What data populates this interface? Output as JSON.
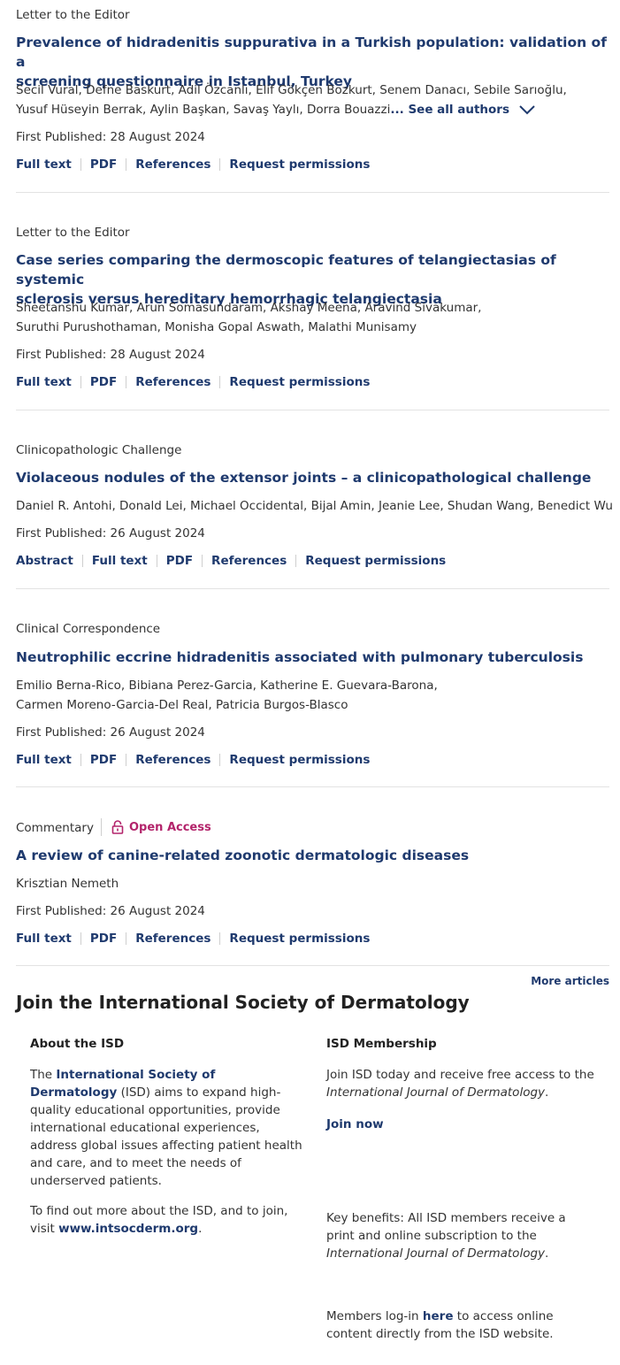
{
  "articles": [
    {
      "type": "Letter to the Editor",
      "title_lines": [
        "Prevalence of hidradenitis suppurativa in a Turkish population: validation of a",
        "screening questionnaire in Istanbul, Turkey"
      ],
      "author_lines": [
        "Secil Vural, Defne Baskurt, Adil Özcanlı, Elif Gökçen Bozkurt, Senem Danacı, Sebile Sarıoğlu,",
        "Yusuf Hüseyin Berrak, Aylin Başkan, Savaş Yaylı, Dorra Bouazzi"
      ],
      "see_all": "... See all authors",
      "first_published": "First Published:  28 August 2024",
      "links": [
        "Full text",
        "PDF",
        "References",
        "Request permissions"
      ]
    },
    {
      "type": "Letter to the Editor",
      "title_lines": [
        "Case series comparing the dermoscopic features of telangiectasias of systemic",
        "sclerosis versus hereditary hemorrhagic telangiectasia"
      ],
      "author_lines": [
        "Sheetanshu Kumar, Arun Somasundaram, Akshay Meena, Aravind Sivakumar,",
        "Suruthi Purushothaman, Monisha Gopal Aswath, Malathi Munisamy"
      ],
      "first_published": "First Published:  28 August 2024",
      "links": [
        "Full text",
        "PDF",
        "References",
        "Request permissions"
      ]
    },
    {
      "type": "Clinicopathologic Challenge",
      "title_lines": [
        "Violaceous nodules of the extensor joints – a clinicopathological challenge"
      ],
      "author_lines": [
        "Daniel R. Antohi, Donald Lei, Michael Occidental, Bijal Amin, Jeanie Lee, Shudan Wang, Benedict Wu"
      ],
      "first_published": "First Published:  26 August 2024",
      "links": [
        "Abstract",
        "Full text",
        "PDF",
        "References",
        "Request permissions"
      ]
    },
    {
      "type": "Clinical Correspondence",
      "title_lines": [
        "Neutrophilic eccrine hidradenitis associated with pulmonary tuberculosis"
      ],
      "author_lines": [
        "Emilio Berna-Rico, Bibiana Perez-Garcia, Katherine E. Guevara-Barona,",
        "Carmen Moreno-Garcia-Del Real, Patricia Burgos-Blasco"
      ],
      "first_published": "First Published:  26 August 2024",
      "links": [
        "Full text",
        "PDF",
        "References",
        "Request permissions"
      ]
    },
    {
      "type": "Commentary",
      "open_access": "Open Access",
      "title_lines": [
        "A review of canine-related zoonotic dermatologic diseases"
      ],
      "author_lines": [
        "Krisztian Nemeth"
      ],
      "first_published": "First Published:  26 August 2024",
      "links": [
        "Full text",
        "PDF",
        "References",
        "Request permissions"
      ]
    }
  ],
  "more_articles": "More articles",
  "isd": {
    "title": "Join the International Society of Dermatology",
    "about": {
      "heading": "About the ISD",
      "p1_pre": "The ",
      "p1_link": "International Society of Dermatology",
      "p1_post": " (ISD) aims to expand high-quality educational opportunities, provide international educational experiences, address global issues affecting patient health and care, and to meet the needs of underserved patients.",
      "p2_pre": "To find out more about the ISD, and to join, visit ",
      "p2_link": "www.intsocderm.org",
      "p2_post": "."
    },
    "membership": {
      "heading": "ISD Membership",
      "p1_pre": "Join ISD today and receive free access to the ",
      "p1_italic": "International Journal of Dermatology",
      "p1_post": ".",
      "join_now": "Join now",
      "p2_pre": "Key benefits: All ISD members receive a print and online subscription to the ",
      "p2_italic": "International Journal of Dermatology",
      "p2_post": ".",
      "p3_pre": "Members log-in ",
      "p3_link": "here",
      "p3_post": " to access online content directly from the ISD website."
    }
  },
  "colors": {
    "link": "#1f3a6e",
    "open_access": "#b3246b",
    "divider": "#e3e3e3"
  },
  "icons": {
    "see_all": "chevron-down-icon",
    "open_access": "lock-icon"
  }
}
